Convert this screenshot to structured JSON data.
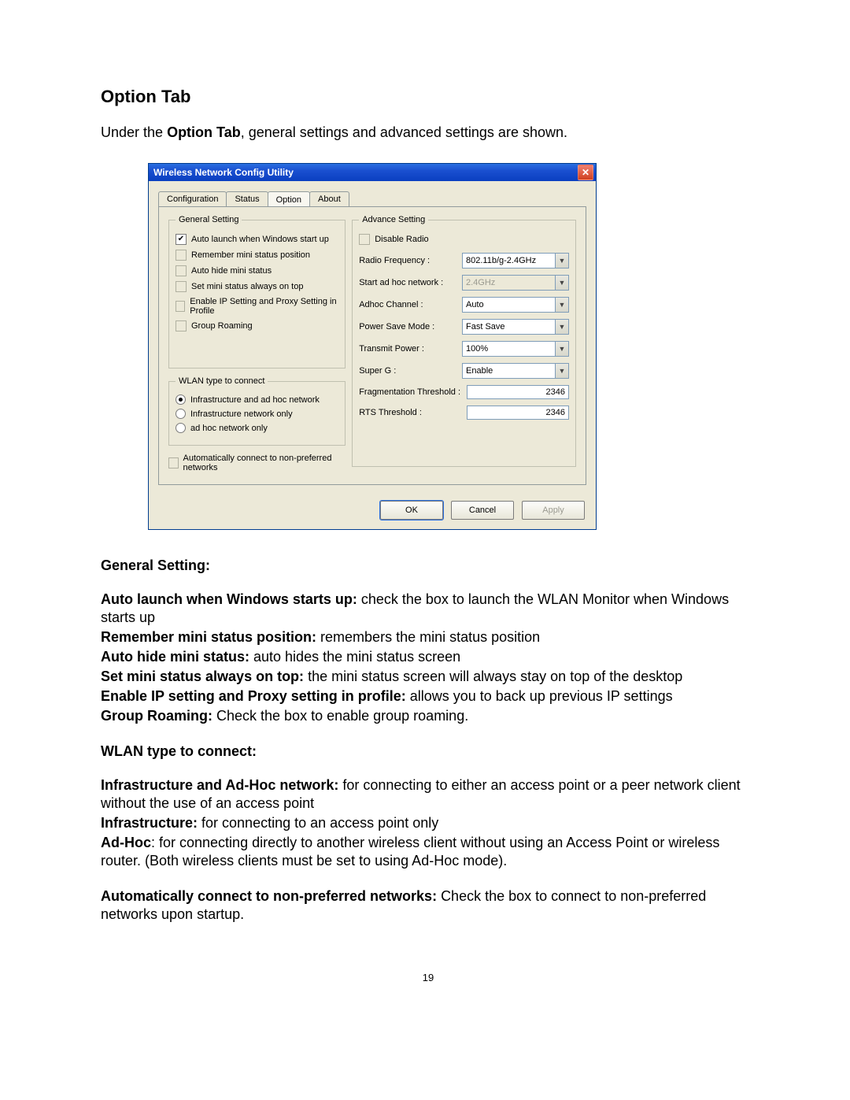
{
  "doc": {
    "title": "Option Tab",
    "intro_pre": "Under the ",
    "intro_bold": "Option Tab",
    "intro_post": ", general settings and advanced settings are shown.",
    "page_number": "19"
  },
  "dialog": {
    "title": "Wireless Network Config Utility",
    "tabs": {
      "configuration": "Configuration",
      "status": "Status",
      "option": "Option",
      "about": "About"
    },
    "general": {
      "legend": "General Setting",
      "auto_launch": "Auto launch when Windows start up",
      "remember_pos": "Remember mini status position",
      "auto_hide": "Auto hide mini status",
      "always_top": "Set mini status always on top",
      "enable_ip": "Enable IP Setting and Proxy Setting in Profile",
      "group_roaming": "Group Roaming"
    },
    "wlan": {
      "legend": "WLAN type to connect",
      "infra_adhoc": "Infrastructure and ad hoc network",
      "infra_only": "Infrastructure network only",
      "adhoc_only": "ad hoc network only"
    },
    "auto_connect": "Automatically connect to non-preferred networks",
    "advance": {
      "legend": "Advance Setting",
      "disable_radio": "Disable Radio",
      "radio_freq_label": "Radio Frequency :",
      "radio_freq_value": "802.11b/g-2.4GHz",
      "start_adhoc_label": "Start ad hoc network :",
      "start_adhoc_value": "2.4GHz",
      "adhoc_channel_label": "Adhoc Channel :",
      "adhoc_channel_value": "Auto",
      "power_save_label": "Power Save Mode :",
      "power_save_value": "Fast Save",
      "transmit_power_label": "Transmit Power :",
      "transmit_power_value": "100%",
      "superg_label": "Super G :",
      "superg_value": "Enable",
      "frag_label": "Fragmentation Threshold :",
      "frag_value": "2346",
      "rts_label": "RTS Threshold :",
      "rts_value": "2346"
    },
    "buttons": {
      "ok": "OK",
      "cancel": "Cancel",
      "apply": "Apply"
    }
  },
  "desc": {
    "general_heading": "General Setting:",
    "auto_launch_b": "Auto launch when Windows starts up: ",
    "auto_launch_t": "check the box to launch the WLAN Monitor when Windows starts up",
    "remember_b": "Remember mini status position: ",
    "remember_t": "remembers the mini status position",
    "autohide_b": "Auto hide mini status: ",
    "autohide_t": "auto hides the mini status screen",
    "ontop_b": "Set mini status always on top: ",
    "ontop_t": "the mini status screen will always stay on top of the desktop",
    "enableip_b": "Enable IP setting and Proxy setting in profile: ",
    "enableip_t": "allows you to back up previous IP settings",
    "roaming_b": "Group Roaming: ",
    "roaming_t": "Check the box to enable group roaming.",
    "wlan_heading": "WLAN type to connect:",
    "infra_adhoc_b": "Infrastructure and Ad-Hoc network: ",
    "infra_adhoc_t": "for connecting to either an access point or a peer network client without the use of an access point",
    "infra_b": "Infrastructure: ",
    "infra_t": "for connecting to an access point only",
    "adhoc_b": "Ad-Hoc",
    "adhoc_t": ": for connecting directly to another wireless client without using an Access Point or wireless router. (Both wireless clients must be set to using Ad-Hoc mode).",
    "autoconn_b": "Automatically connect to non-preferred networks: ",
    "autoconn_t": "Check the box to connect to non-preferred networks upon startup."
  }
}
